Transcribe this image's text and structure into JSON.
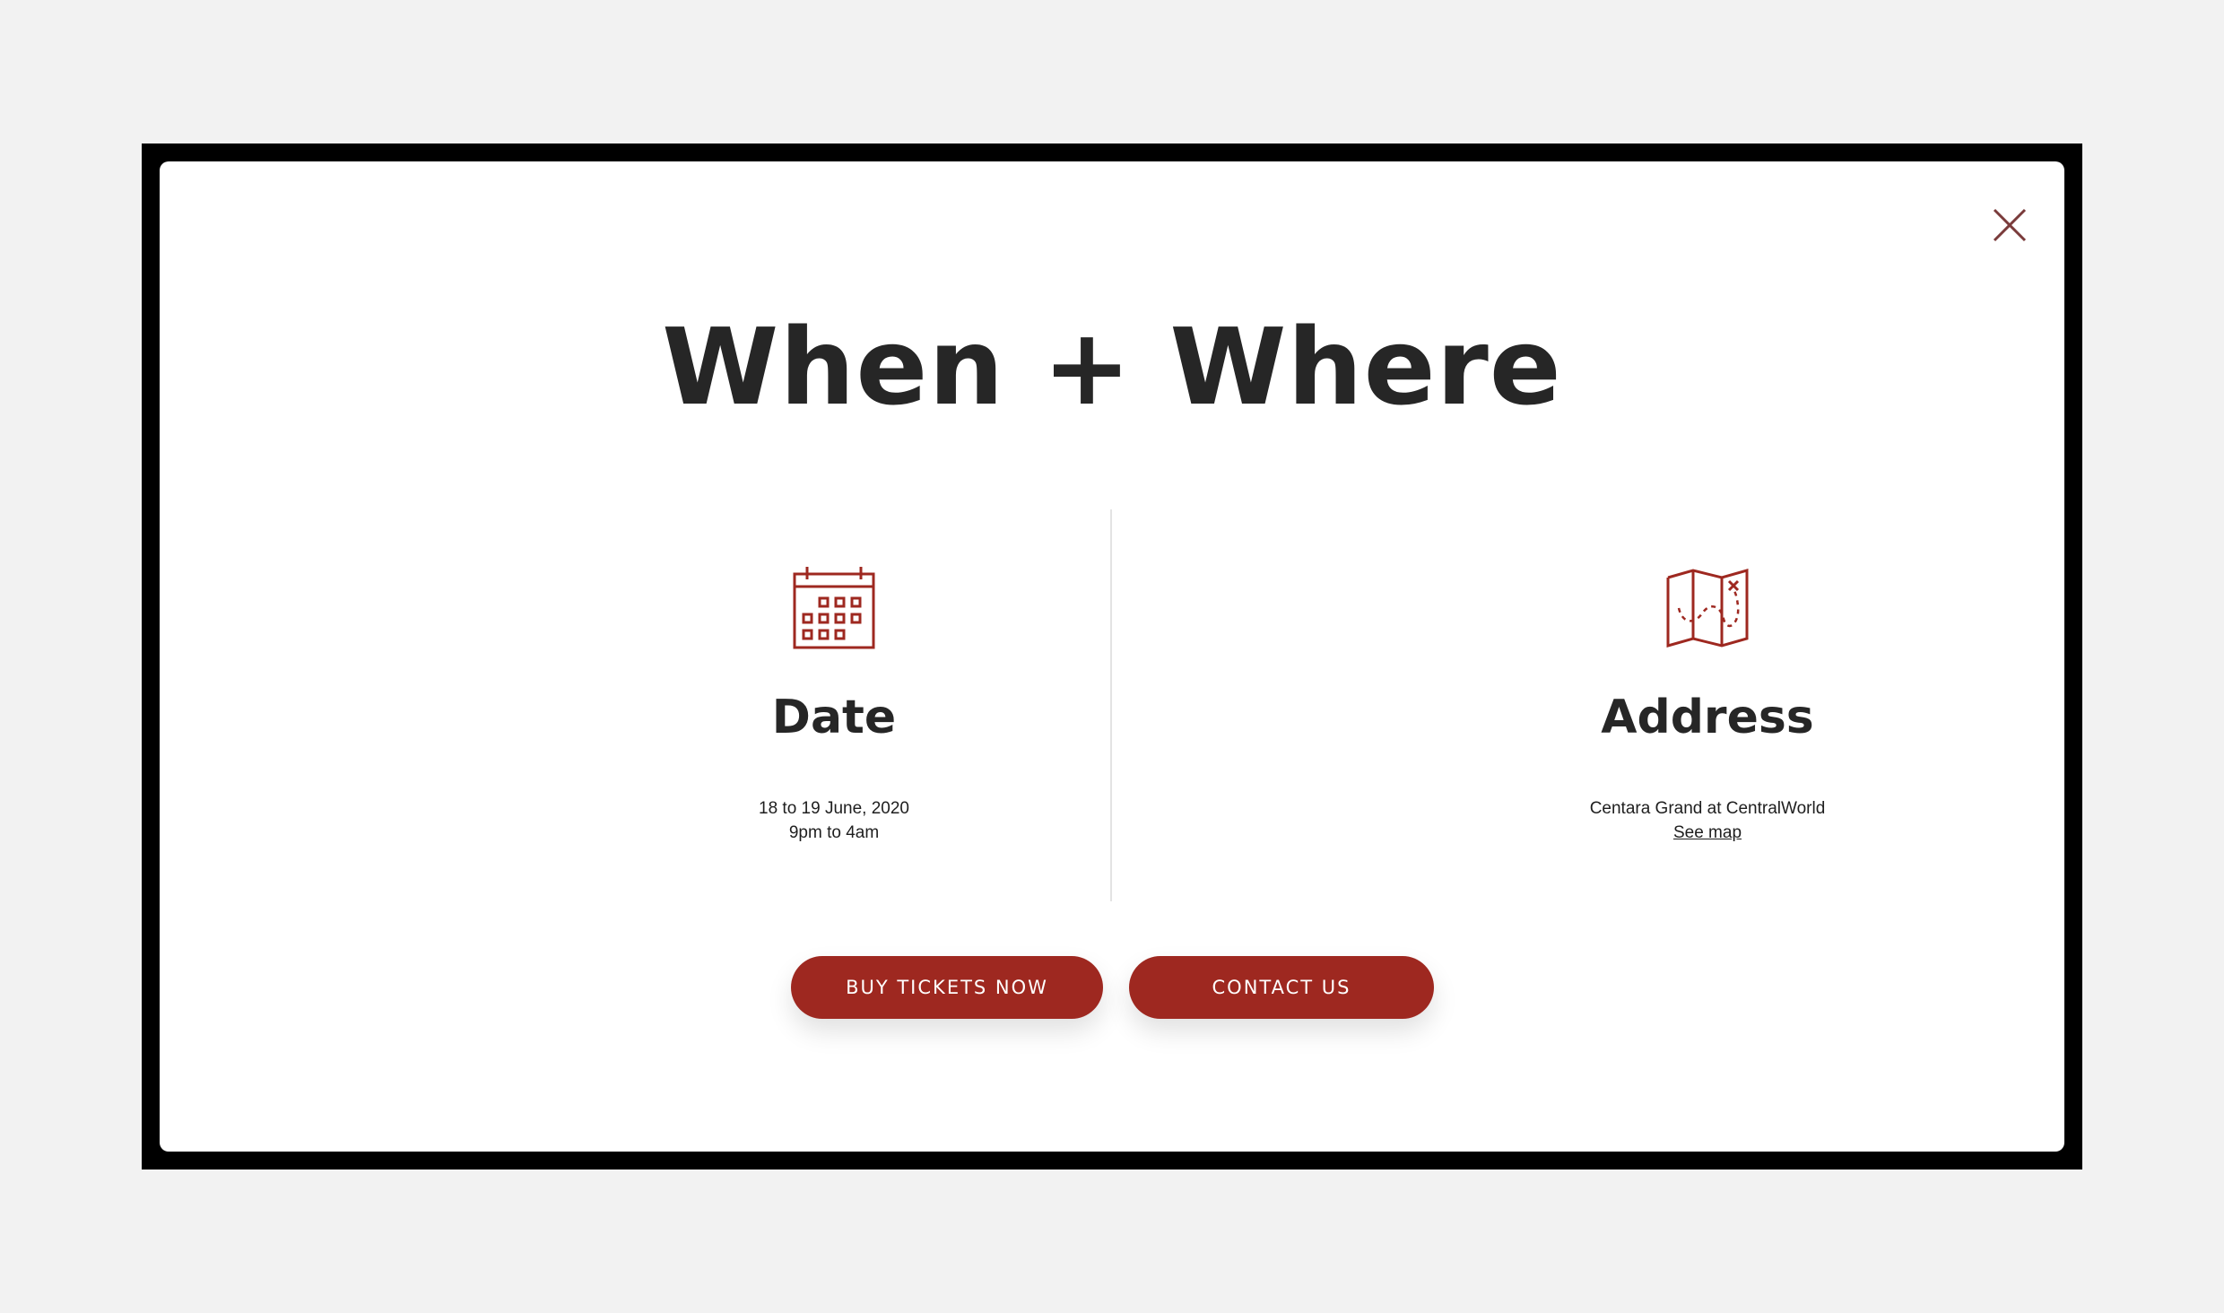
{
  "modal": {
    "title": "When + Where",
    "close_icon": "close-icon"
  },
  "date": {
    "icon": "calendar-icon",
    "heading": "Date",
    "line1": "18 to 19 June, 2020",
    "line2": "9pm to 4am"
  },
  "address": {
    "icon": "map-icon",
    "heading": "Address",
    "venue": "Centara Grand at CentralWorld",
    "map_link": "See map"
  },
  "buttons": {
    "buy": "BUY TICKETS NOW",
    "contact": "CONTACT US"
  },
  "colors": {
    "accent": "#9e2820",
    "heading": "#262626",
    "page_background": "#f2f2f2",
    "frame": "#000000"
  }
}
